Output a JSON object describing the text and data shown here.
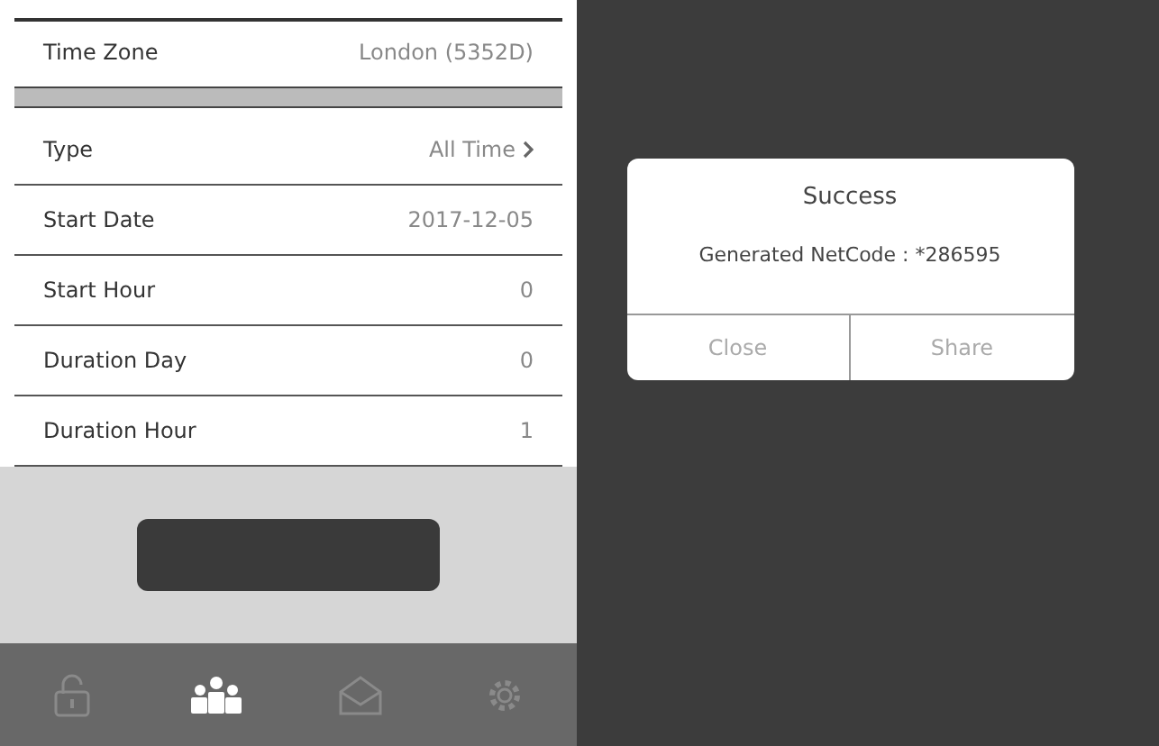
{
  "settings": [
    {
      "label": "Time Zone",
      "value": "London (5352D)",
      "kind": "text"
    },
    {
      "kind": "separator"
    },
    {
      "label": "Type",
      "value": "All Time",
      "kind": "link"
    },
    {
      "label": "Start Date",
      "value": "2017-12-05",
      "kind": "text"
    },
    {
      "label": "Start Hour",
      "value": "0",
      "kind": "text"
    },
    {
      "label": "Duration Day",
      "value": "0",
      "kind": "text"
    },
    {
      "label": "Duration Hour",
      "value": "1",
      "kind": "text"
    }
  ],
  "tabs": [
    {
      "kind": "lock",
      "selected": false
    },
    {
      "kind": "people",
      "selected": true
    },
    {
      "kind": "mail",
      "selected": false
    },
    {
      "kind": "gear",
      "selected": false
    }
  ],
  "dialog": {
    "title": "Success",
    "message": "Generated NetCode : *286595",
    "buttons": [
      "Close",
      "Share"
    ]
  }
}
